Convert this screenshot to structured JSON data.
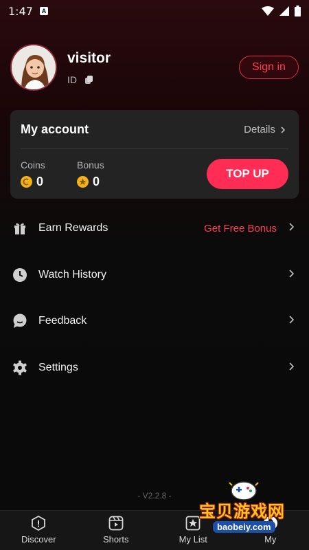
{
  "status_bar": {
    "time": "1:47",
    "badge": "A"
  },
  "profile": {
    "username": "visitor",
    "id_label": "ID",
    "signin_label": "Sign in"
  },
  "account": {
    "title": "My account",
    "details_label": "Details",
    "coins_label": "Coins",
    "coins_value": "0",
    "bonus_label": "Bonus",
    "bonus_value": "0",
    "topup_label": "TOP UP"
  },
  "menu": {
    "earn_rewards": {
      "label": "Earn Rewards",
      "promo": "Get Free Bonus",
      "icon": "gift-icon"
    },
    "watch_history": {
      "label": "Watch History",
      "icon": "clock-icon"
    },
    "feedback": {
      "label": "Feedback",
      "icon": "chat-bubble-icon"
    },
    "settings": {
      "label": "Settings",
      "icon": "gear-icon"
    }
  },
  "version": "- V2.2.8 -",
  "tabs": [
    {
      "label": "Discover",
      "icon": "discover-icon"
    },
    {
      "label": "Shorts",
      "icon": "shorts-icon"
    },
    {
      "label": "My List",
      "icon": "star-list-icon"
    },
    {
      "label": "My",
      "icon": "profile-icon"
    }
  ],
  "watermark": {
    "title": "宝贝游戏网",
    "url": "baobeiy.com"
  },
  "colors": {
    "accent": "#ff2d55",
    "card": "#232323",
    "coin": "#f2b21b"
  }
}
